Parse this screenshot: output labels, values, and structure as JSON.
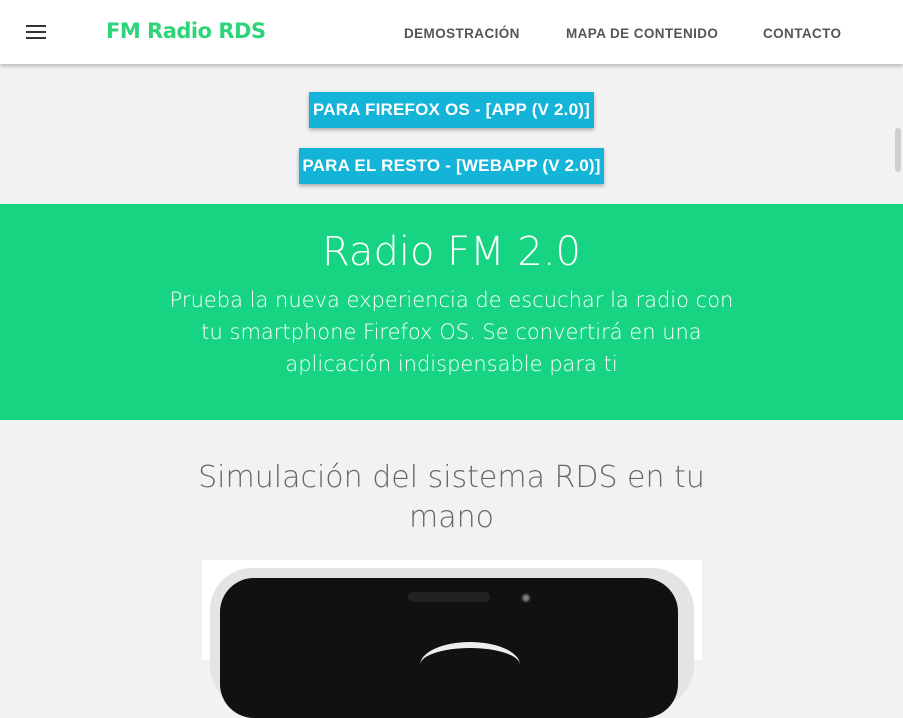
{
  "header": {
    "brand": "FM Radio RDS",
    "nav": [
      {
        "label": "DEMOSTRACIÓN"
      },
      {
        "label": "MAPA DE CONTENIDO"
      },
      {
        "label": "CONTACTO"
      }
    ]
  },
  "downloads": {
    "firefox_button": "PARA FIREFOX OS - [APP (V 2.0)]",
    "others_button": "PARA EL RESTO - [WEBAPP (V 2.0)]"
  },
  "hero": {
    "title": "Radio FM 2.0",
    "subtitle": "Prueba la nueva experiencia de escuchar la radio con tu smartphone Firefox OS. Se convertirá en una aplicación indispensable para ti"
  },
  "section": {
    "title": "Simulación del sistema RDS en tu mano"
  },
  "colors": {
    "brand": "#2ed47a",
    "hero_bg": "#17d483",
    "button_bg": "#14b4d8"
  },
  "icons": [
    "menu-icon"
  ]
}
